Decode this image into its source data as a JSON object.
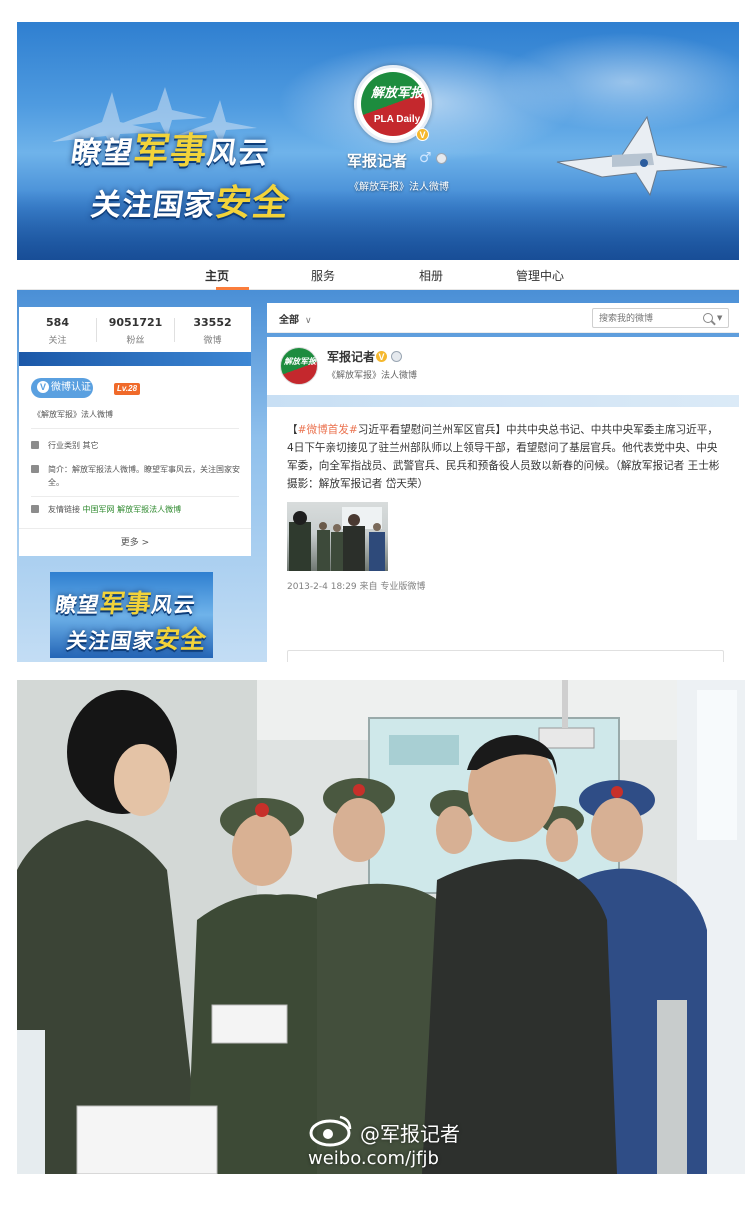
{
  "banner": {
    "slogan_line1_a": "瞭望",
    "slogan_line1_b": "军事",
    "slogan_line1_c": "风云",
    "slogan_line2_a": "关注国家",
    "slogan_line2_b": "安全",
    "logo_script": "解放军报",
    "logo_text": "PLA Daily",
    "verified_mark": "V",
    "account_name": "军报记者",
    "gender_symbol": "♂",
    "account_desc": "《解放军报》法人微博"
  },
  "nav": {
    "items": [
      "主页",
      "服务",
      "相册",
      "管理中心"
    ],
    "active": "主页"
  },
  "stats": [
    {
      "value": "584",
      "label": "关注"
    },
    {
      "value": "9051721",
      "label": "粉丝"
    },
    {
      "value": "33552",
      "label": "微博"
    }
  ],
  "profile_card": {
    "verify_label": "微博认证",
    "verify_mark": "V",
    "level_badge": "Lv.28",
    "verify_desc": "《解放军报》法人微博",
    "industry_label": "行业类别",
    "industry_value": "其它",
    "intro_label": "简介：",
    "intro_text": "解放军报法人微博。瞭望军事风云，关注国家安全。",
    "links_label": "友情链接",
    "link1": "中国军网",
    "link2": "解放军报法人微博",
    "more_label": "更多",
    "more_chevron": ">"
  },
  "small_banner": {
    "line1_a": "瞭望",
    "line1_b": "军事",
    "line1_c": "风云",
    "line2_a": "关注国家",
    "line2_b": "安全"
  },
  "feed": {
    "filter_label": "全部",
    "filter_chevron": "∨",
    "search_placeholder": "搜索我的微博",
    "search_caret": "▼"
  },
  "post": {
    "author": "军报记者",
    "verified_mark": "V",
    "author_desc": "《解放军报》法人微博",
    "avatar_text": "解放军报",
    "topic_open": "【",
    "topic_tag": "#微博首发#",
    "headline": "习近平看望慰问兰州军区官兵】",
    "body": "中共中央总书记、中共中央军委主席习近平，4日下午亲切接见了驻兰州部队师以上领导干部，看望慰问了基层官兵。他代表党中央、中央军委，向全军指战员、武警官兵、民兵和预备役人员致以新春的问候。（解放军报记者 王士彬 摄影：解放军报记者 岱天荣）",
    "meta": "2013-2-4 18:29 来自 专业版微博"
  },
  "watermark": {
    "account": "@军报记者",
    "url": "weibo.com/jfjb"
  },
  "colors": {
    "accent_orange": "#fa7d3c",
    "topic_orange": "#eb7350",
    "verify_blue": "#5aa0e0",
    "link_green": "#2f8a2f",
    "level_orange": "#f06a2a",
    "verified_gold": "#f5b82e"
  },
  "icons": [
    "verified-badge-icon",
    "male-icon",
    "member-grade-icon",
    "briefcase-icon",
    "intro-icon",
    "link-icon",
    "search-icon",
    "weibo-eye-icon"
  ]
}
